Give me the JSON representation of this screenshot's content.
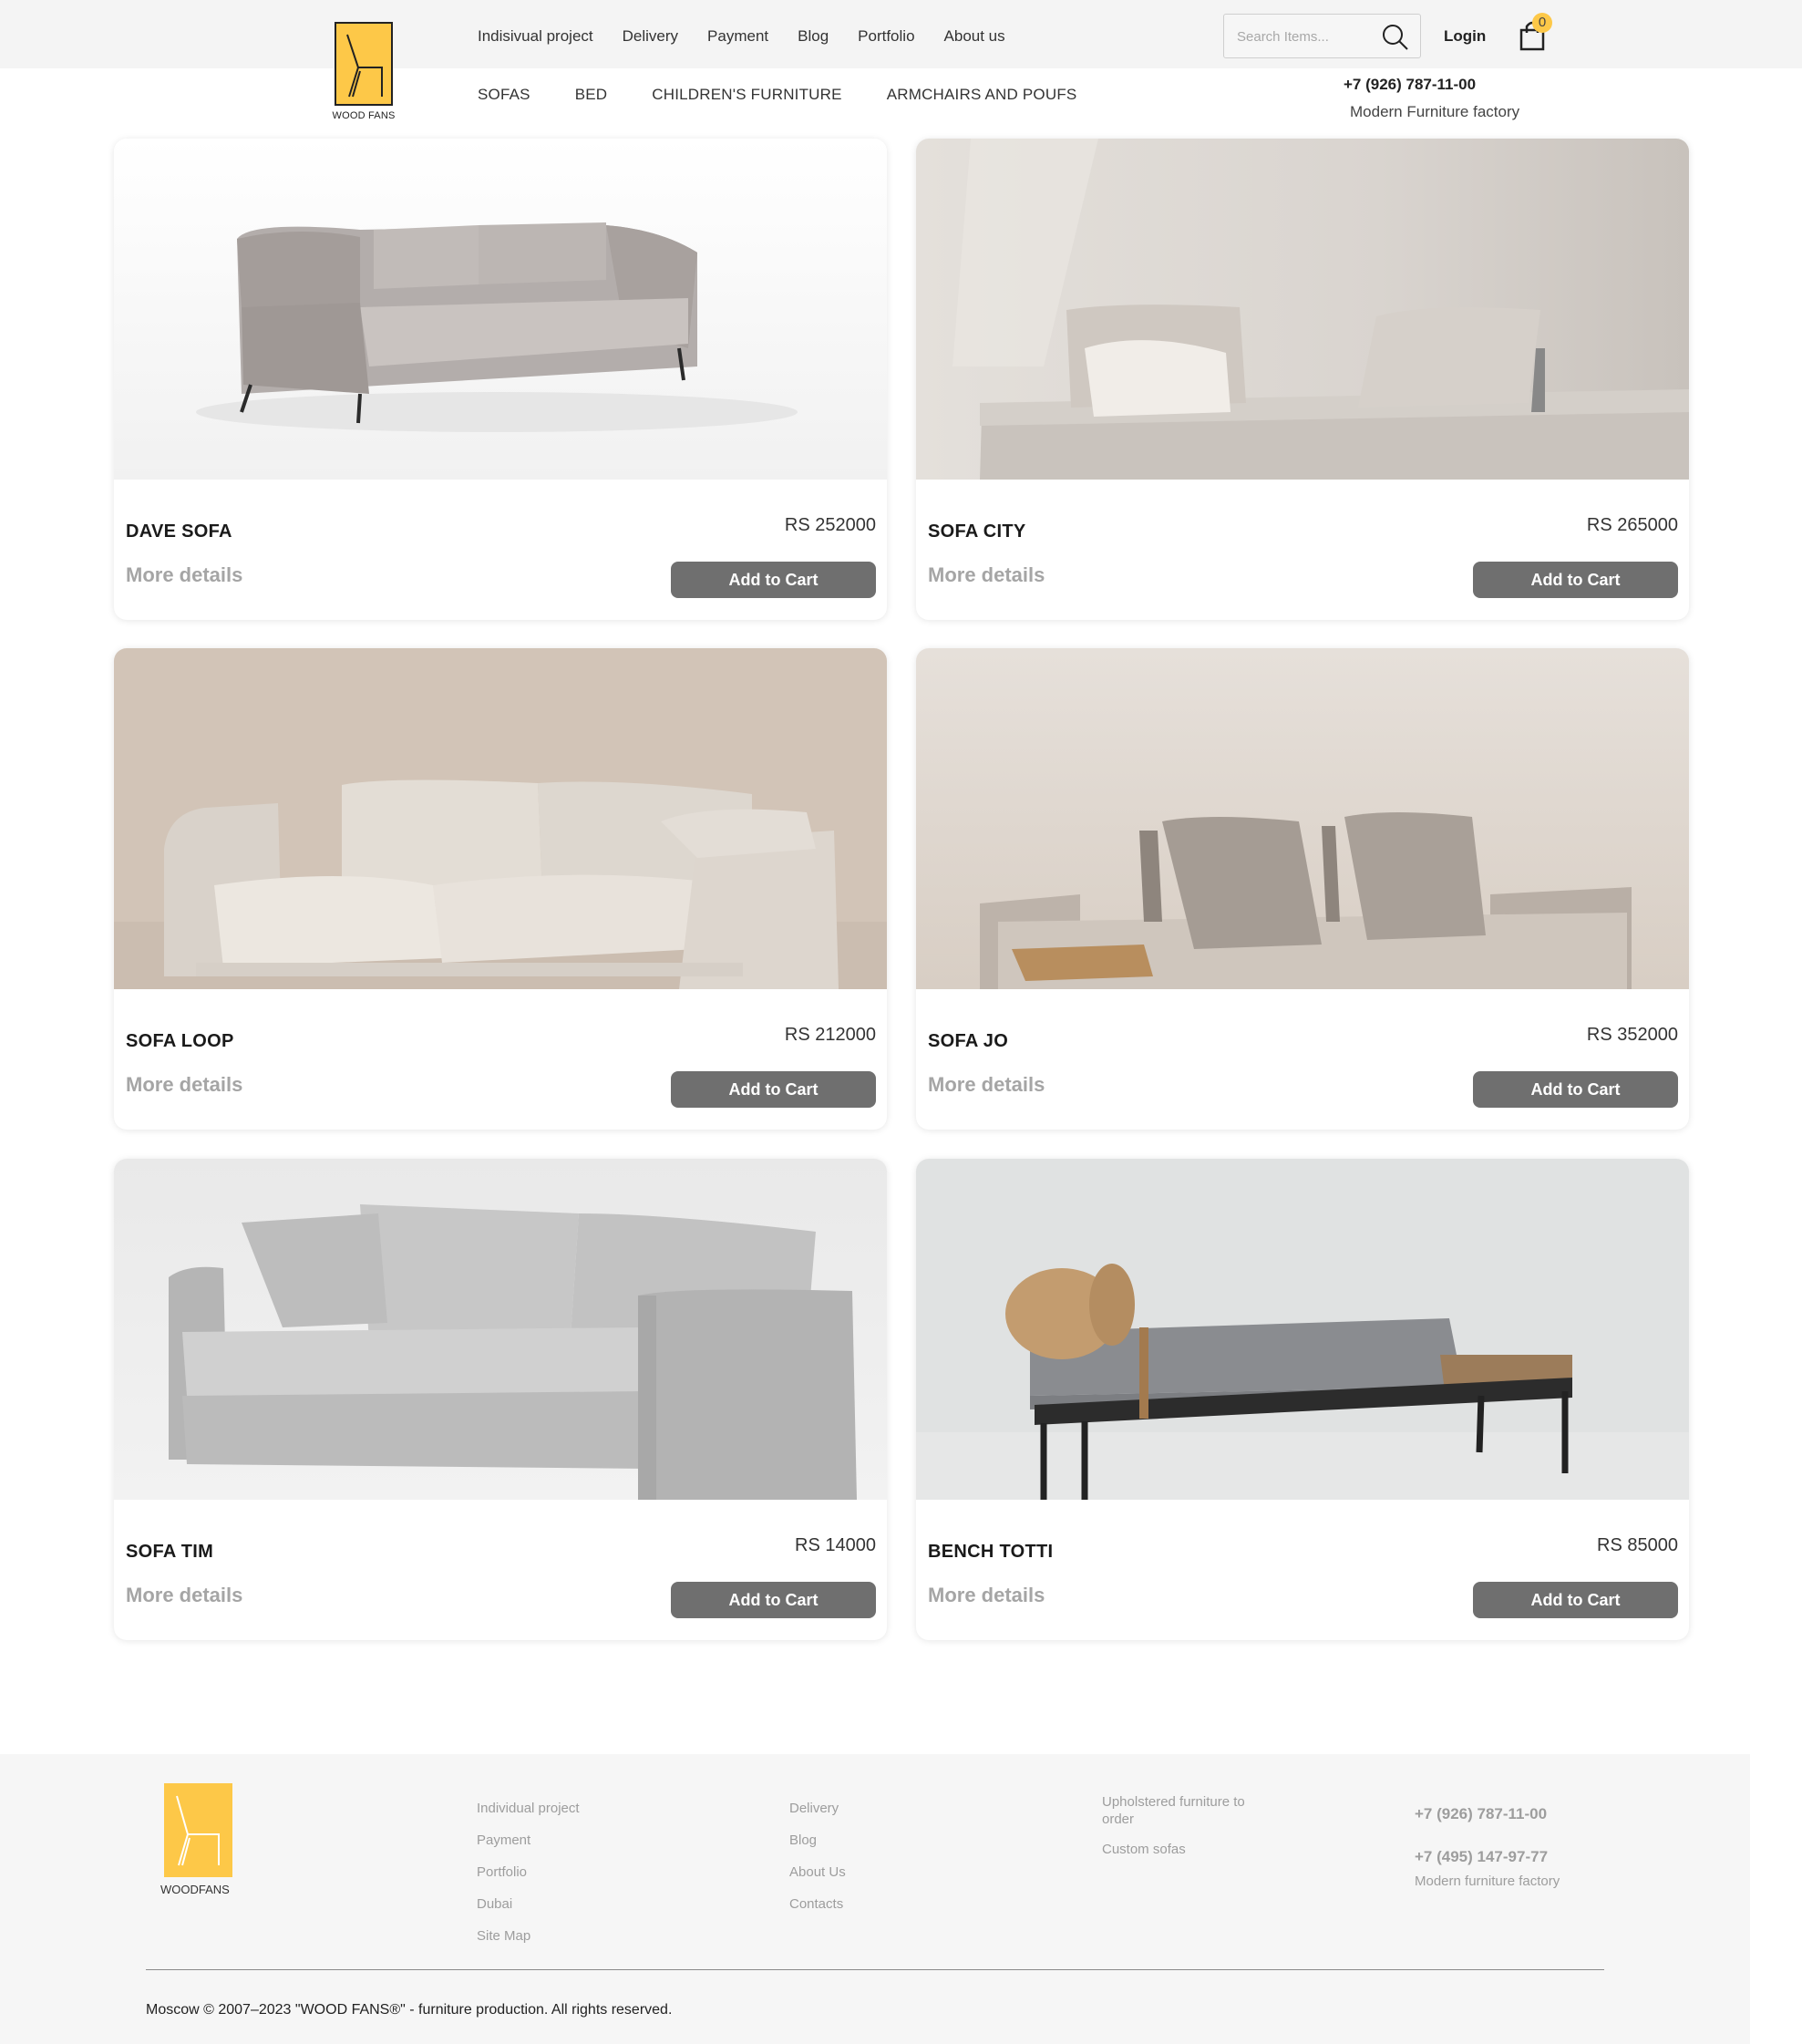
{
  "header": {
    "logo_text": "WOOD FANS",
    "nav_top": [
      "Indisivual project",
      "Delivery",
      "Payment",
      "Blog",
      "Portfolio",
      "About us"
    ],
    "nav_categories": [
      "SOFAS",
      "BED",
      "CHILDREN'S FURNITURE",
      "ARMCHAIRS AND POUFS"
    ],
    "search_placeholder": "Search Items...",
    "login_label": "Login",
    "cart_count": "0",
    "phone": "+7 (926) 787-11-00",
    "tagline": "Modern Furniture factory"
  },
  "products": [
    {
      "name": "DAVE SOFA",
      "price": "RS 252000",
      "more": "More details",
      "cta": "Add to Cart"
    },
    {
      "name": "SOFA CITY",
      "price": "RS 265000",
      "more": "More details",
      "cta": "Add to Cart"
    },
    {
      "name": "SOFA LOOP",
      "price": "RS 212000",
      "more": "More details",
      "cta": "Add to Cart"
    },
    {
      "name": "SOFA JO",
      "price": "RS 352000",
      "more": "More details",
      "cta": "Add to Cart"
    },
    {
      "name": "SOFA TIM",
      "price": "RS 14000",
      "more": "More details",
      "cta": "Add to Cart"
    },
    {
      "name": "BENCH TOTTI",
      "price": "RS 85000",
      "more": "More details",
      "cta": "Add to Cart"
    }
  ],
  "footer": {
    "logo_text": "WOODFANS",
    "col1": [
      "Individual project",
      "Payment",
      "Portfolio",
      "Dubai",
      "Site Map"
    ],
    "col2": [
      "Delivery",
      "Blog",
      "About Us",
      "Contacts"
    ],
    "col3": [
      "Upholstered furniture to order",
      "Custom sofas"
    ],
    "phone1": "+7 (926) 787-11-00",
    "phone2": "+7 (495) 147-97-77",
    "tagline": "Modern furniture factory",
    "copyright": "Moscow © 2007–2023 \"WOOD FANS®\" - furniture production. All rights reserved."
  },
  "colors": {
    "accent": "#fdc848",
    "button": "#6f6f6f",
    "muted": "#a5a5a5"
  }
}
